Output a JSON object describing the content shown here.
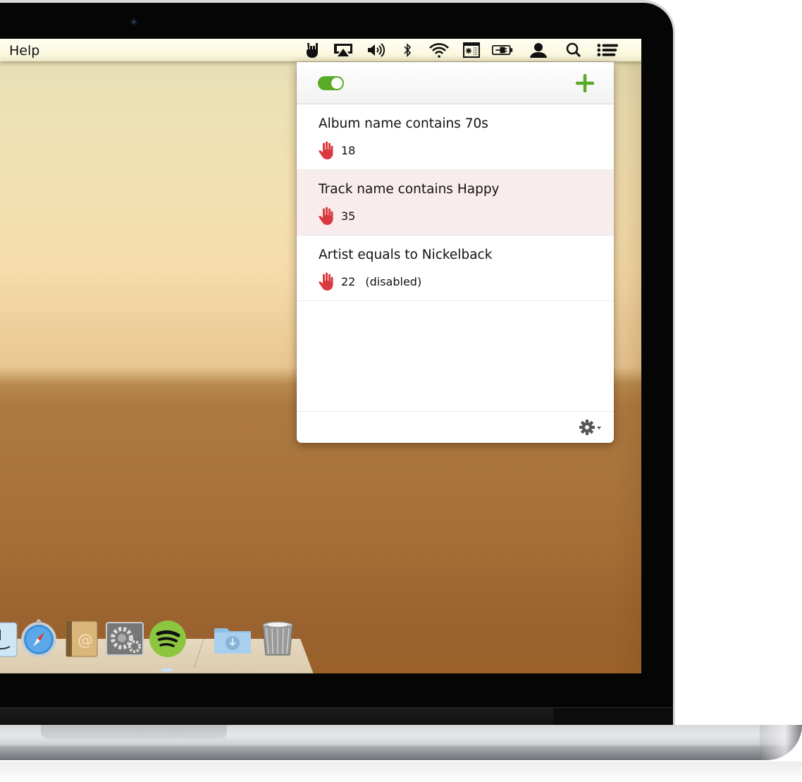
{
  "menubar": {
    "menu_items": [
      {
        "label": "Help"
      }
    ],
    "status_icons": [
      {
        "name": "rock-hand-app-icon"
      },
      {
        "name": "airplay-icon"
      },
      {
        "name": "volume-icon"
      },
      {
        "name": "bluetooth-icon"
      },
      {
        "name": "wifi-icon"
      },
      {
        "name": "window-manager-icon"
      },
      {
        "name": "battery-charging-icon"
      },
      {
        "name": "user-icon"
      },
      {
        "name": "spotlight-search-icon"
      },
      {
        "name": "notification-center-icon"
      }
    ]
  },
  "popover": {
    "enabled": true,
    "accent_color": "#58ab27",
    "add_button_label": "+",
    "rules": [
      {
        "title": "Album name contains 70s",
        "count": "18",
        "status": "",
        "selected": false
      },
      {
        "title": "Track name contains Happy",
        "count": "35",
        "status": "",
        "selected": true
      },
      {
        "title": "Artist equals to Nickelback",
        "count": "22",
        "status": "(disabled)",
        "selected": false
      }
    ],
    "hand_icon_color": "#d9393f",
    "settings_button": "gear-icon"
  },
  "dock": {
    "items": [
      {
        "name": "finder"
      },
      {
        "name": "safari"
      },
      {
        "name": "address-book"
      },
      {
        "name": "system-preferences"
      },
      {
        "name": "spotify"
      },
      {
        "name": "downloads-folder"
      },
      {
        "name": "trash"
      }
    ]
  }
}
